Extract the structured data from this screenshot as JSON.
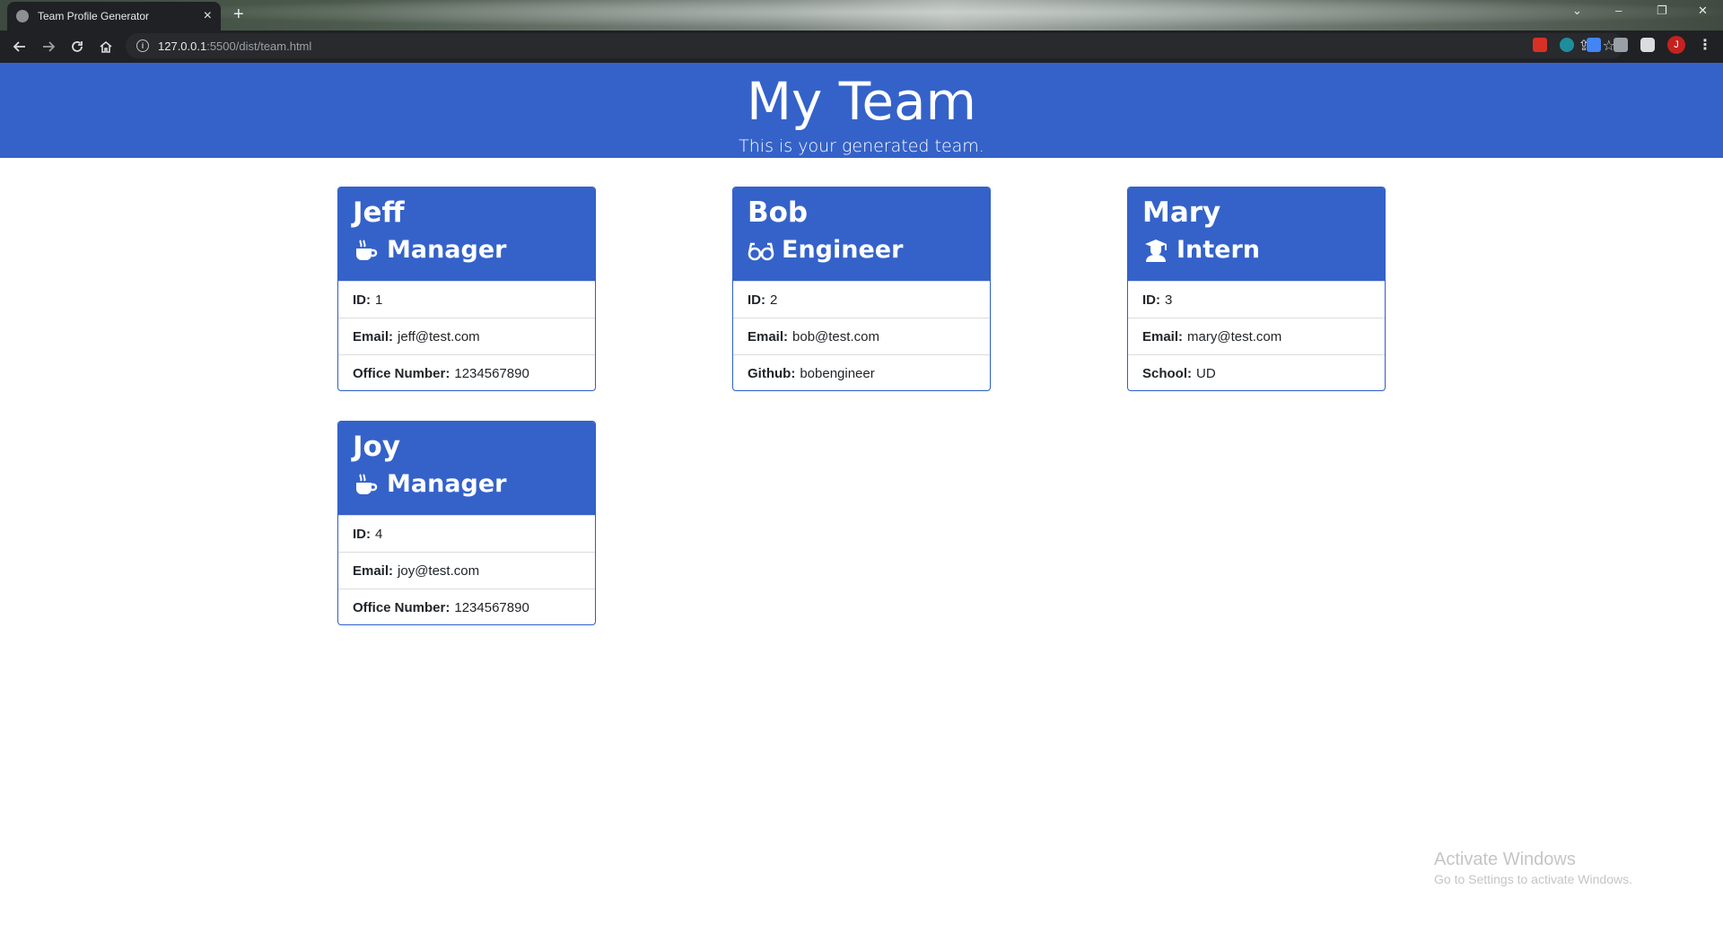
{
  "browser": {
    "tab_title": "Team Profile Generator",
    "url_host": "127.0.0.1",
    "url_rest": ":5500/dist/team.html"
  },
  "header": {
    "title": "My Team",
    "subtitle": "This is your generated team."
  },
  "employees": [
    {
      "name": "Jeff",
      "role": "Manager",
      "icon": "coffee-icon",
      "id_label": "ID:",
      "id": "1",
      "email_label": "Email:",
      "email": "jeff@test.com",
      "extra_label": "Office Number:",
      "extra": "1234567890"
    },
    {
      "name": "Bob",
      "role": "Engineer",
      "icon": "glasses-icon",
      "id_label": "ID:",
      "id": "2",
      "email_label": "Email:",
      "email": "bob@test.com",
      "extra_label": "Github:",
      "extra": "bobengineer"
    },
    {
      "name": "Mary",
      "role": "Intern",
      "icon": "graduate-icon",
      "id_label": "ID:",
      "id": "3",
      "email_label": "Email:",
      "email": "mary@test.com",
      "extra_label": "School:",
      "extra": "UD"
    },
    {
      "name": "Joy",
      "role": "Manager",
      "icon": "coffee-icon",
      "id_label": "ID:",
      "id": "4",
      "email_label": "Email:",
      "email": "joy@test.com",
      "extra_label": "Office Number:",
      "extra": "1234567890"
    }
  ],
  "watermark": {
    "line1": "Activate Windows",
    "line2": "Go to Settings to activate Windows."
  },
  "colors": {
    "primary": "#3462c9",
    "border": "#2f5ec8"
  }
}
